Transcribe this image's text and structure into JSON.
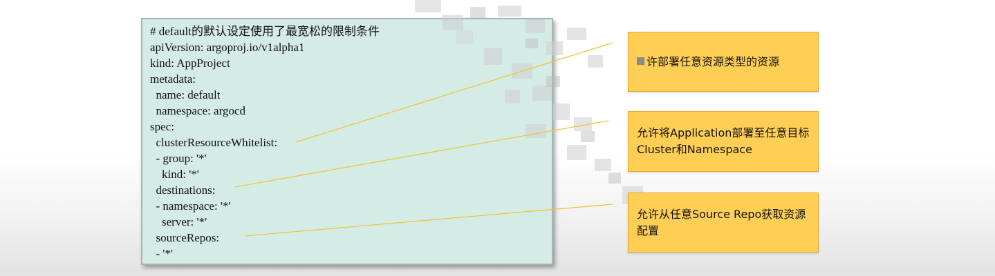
{
  "code": {
    "lines": [
      "# default的默认设定使用了最宽松的限制条件",
      "apiVersion: argoproj.io/v1alpha1",
      "kind: AppProject",
      "metadata:",
      "  name: default",
      "  namespace: argocd",
      "spec:",
      "  clusterResourceWhitelist:",
      "  - group: '*'",
      "    kind: '*'",
      "  destinations:",
      "  - namespace: '*'",
      "    server: '*'",
      "  sourceRepos:",
      "  - '*'"
    ]
  },
  "callouts": [
    {
      "text": "许部署任意资源类型的资源"
    },
    {
      "text": "允许将Application部署至任意目标Cluster和Namespace"
    },
    {
      "text": "允许从任意Source Repo获取资源配置"
    }
  ],
  "colors": {
    "code_background": "#d5ebe6",
    "callout_fill": "#ffcf55",
    "connector_line": "#f2c230"
  }
}
